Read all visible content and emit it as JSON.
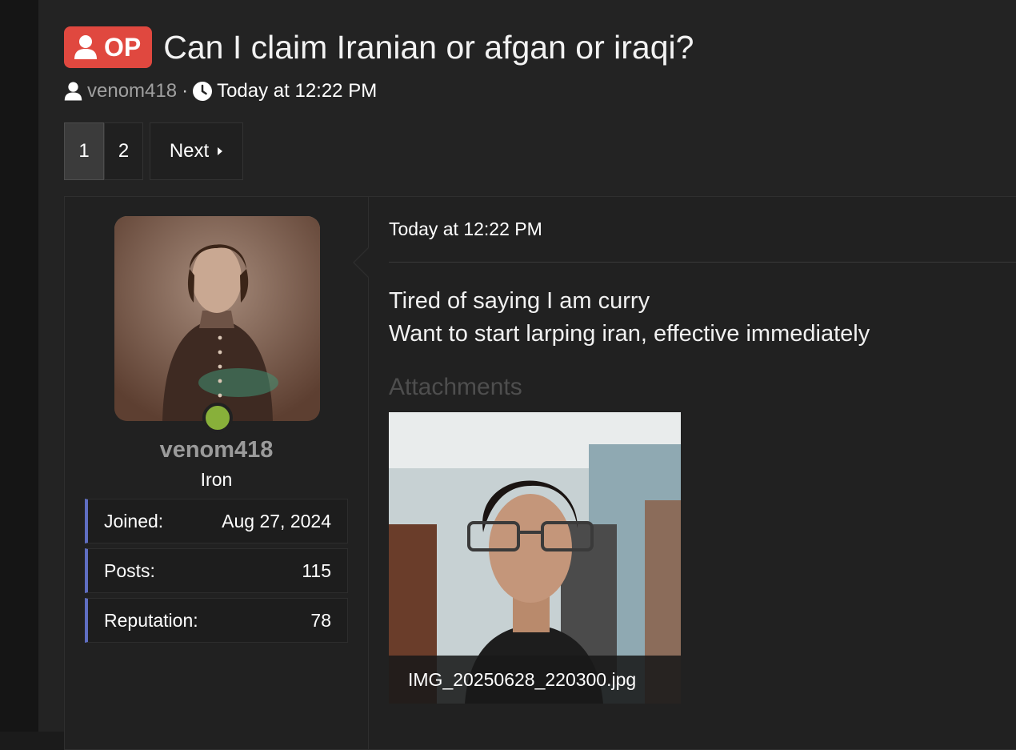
{
  "thread": {
    "badge_label": "OP",
    "title": "Can I claim Iranian or afgan or iraqi?",
    "author": "venom418",
    "separator": "·",
    "timestamp": "Today at 12:22 PM"
  },
  "pagination": {
    "pages": [
      "1",
      "2"
    ],
    "current_page": "1",
    "next_label": "Next"
  },
  "post": {
    "user": {
      "username": "venom418",
      "rank": "Iron",
      "online": true,
      "online_color": "#88b03a",
      "stats": [
        {
          "label": "Joined:",
          "value": "Aug 27, 2024"
        },
        {
          "label": "Posts:",
          "value": "115"
        },
        {
          "label": "Reputation:",
          "value": "78"
        }
      ]
    },
    "timestamp": "Today at 12:22 PM",
    "body_lines": [
      "Tired of saying I am curry",
      "Want to start larping iran, effective immediately"
    ],
    "attachments_heading": "Attachments",
    "attachment": {
      "filename": "IMG_20250628_220300.jpg"
    }
  },
  "colors": {
    "badge": "#e0483f",
    "stat_accent": "#5f6ec2",
    "background": "#232323"
  },
  "icons": [
    "user-icon",
    "clock-icon",
    "caret-right-icon"
  ]
}
